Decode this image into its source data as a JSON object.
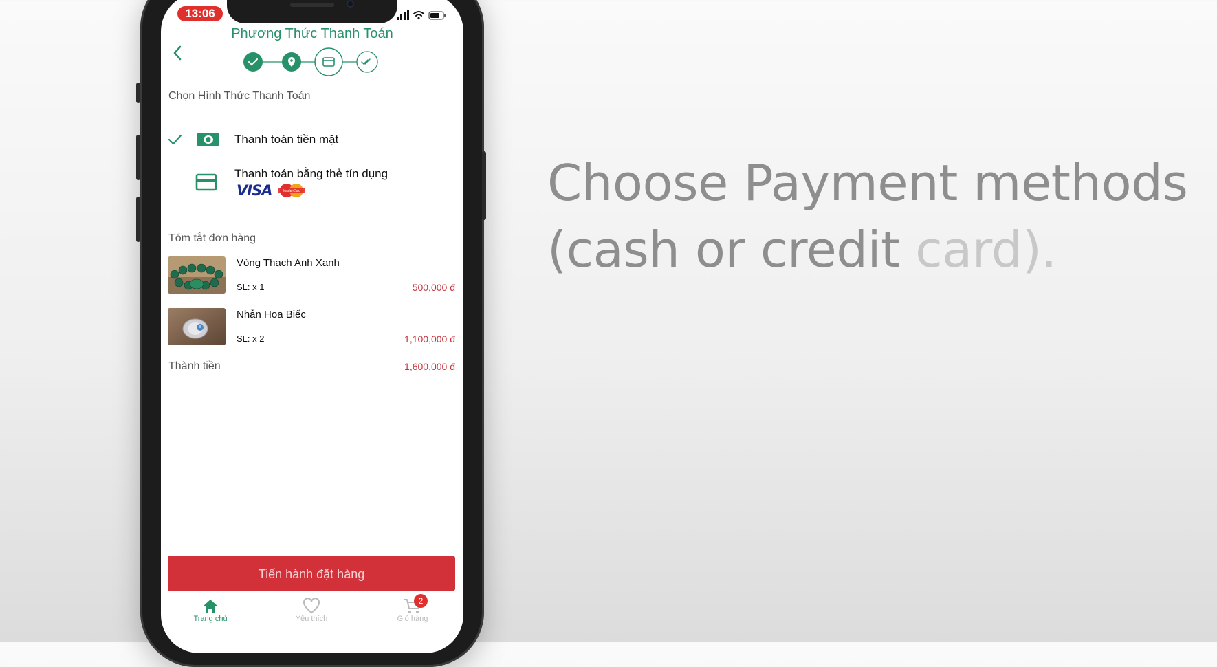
{
  "status_bar": {
    "time": "13:06"
  },
  "header": {
    "title": "Phương Thức Thanh Toán"
  },
  "steps": [
    "check-icon",
    "location-pin-icon",
    "credit-card-icon",
    "double-check-icon"
  ],
  "payment": {
    "section_label": "Chọn Hình Thức Thanh Toán",
    "options": [
      {
        "label": "Thanh toán tiền mặt",
        "icon": "cash-icon",
        "selected": true
      },
      {
        "label": "Thanh toán bằng thẻ tín dụng",
        "icon": "credit-card-icon",
        "selected": false,
        "brands": [
          "VISA",
          "MasterCard"
        ]
      }
    ]
  },
  "summary": {
    "section_label": "Tóm tắt đơn hàng",
    "items": [
      {
        "name": "Vòng Thạch Anh Xanh",
        "qty": "SL: x 1",
        "price": "500,000 đ"
      },
      {
        "name": "Nhẫn Hoa Biếc",
        "qty": "SL: x 2",
        "price": "1,100,000 đ"
      }
    ],
    "total_label": "Thành tiền",
    "total_value": "1,600,000 đ"
  },
  "order_button": "Tiến hành đặt hàng",
  "tabbar": [
    {
      "label": "Trang chủ",
      "icon": "home-icon",
      "active": true
    },
    {
      "label": "Yêu thích",
      "icon": "heart-icon",
      "active": false
    },
    {
      "label": "Giỏ hàng",
      "icon": "cart-icon",
      "active": false,
      "badge": "2"
    }
  ],
  "caption": {
    "line1": "Choose Payment methods",
    "line2_main": "(cash or credit ",
    "line2_dim": "card)."
  },
  "colors": {
    "brand_green": "#27916a",
    "accent_red": "#d3313a",
    "price_red": "#c4343c"
  }
}
